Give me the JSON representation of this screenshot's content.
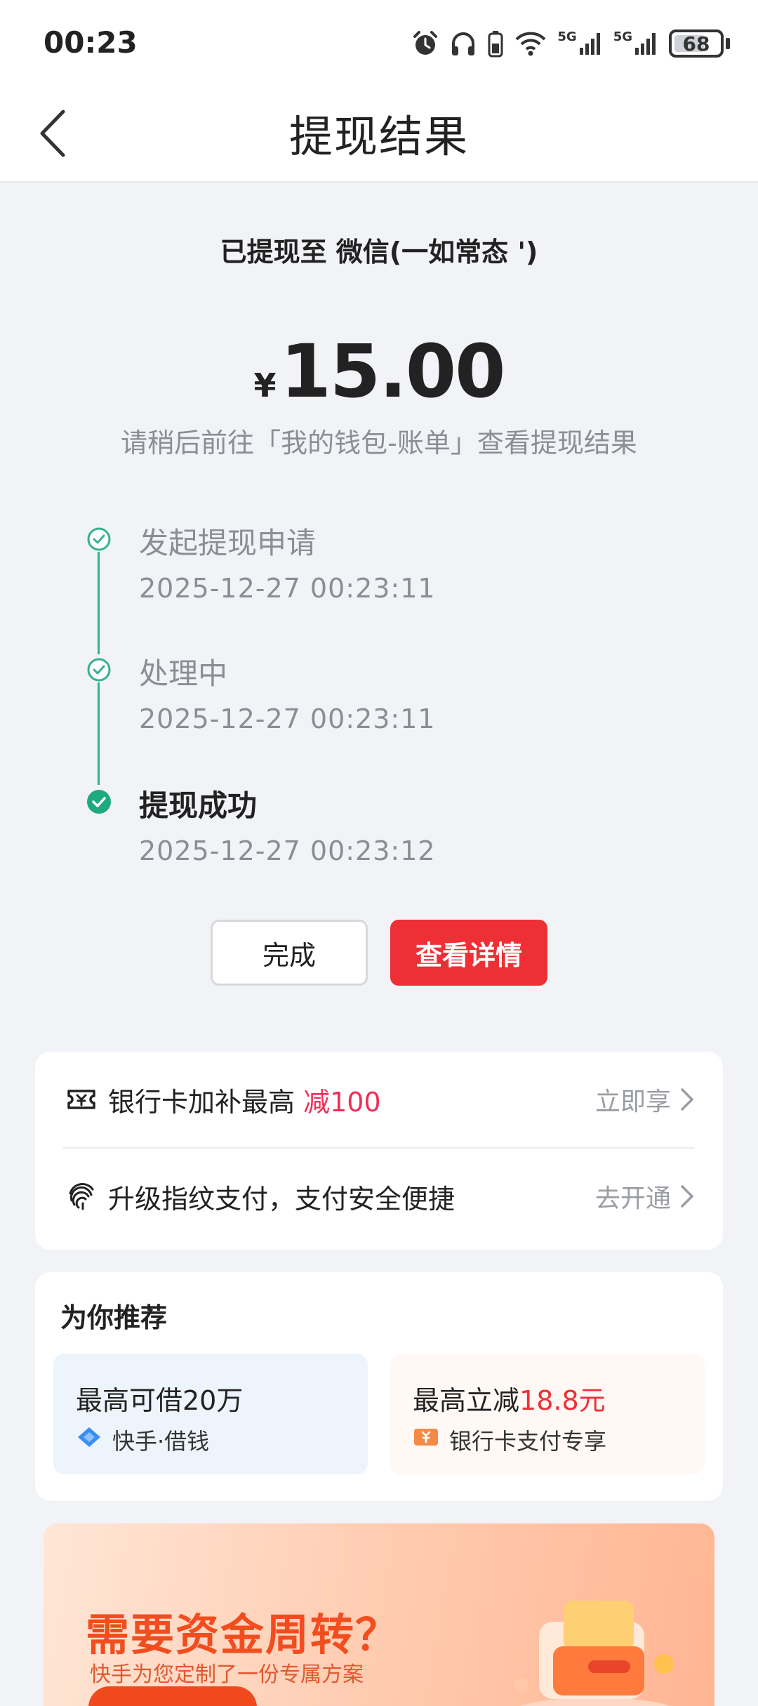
{
  "status_bar": {
    "time": "00:23",
    "battery": "68",
    "battery_level": 0.68,
    "signal_label_1": "5G",
    "signal_label_2": "5G",
    "icons": [
      "alarm-icon",
      "headphones-icon",
      "phone-battery-icon",
      "wifi-icon",
      "signal-5g-icon",
      "signal-5g-icon",
      "battery-icon"
    ]
  },
  "header": {
    "title": "提现结果",
    "back_icon": "chevron-left-icon"
  },
  "result": {
    "destination": "已提现至 微信(一如常态 ')",
    "currency": "¥",
    "amount": "15.00",
    "hint": "请稍后前往「我的钱包-账单」查看提现结果"
  },
  "timeline": [
    {
      "title": "发起提现申请",
      "time": "2025-12-27 00:23:11",
      "state": "passed"
    },
    {
      "title": "处理中",
      "time": "2025-12-27 00:23:11",
      "state": "passed"
    },
    {
      "title": "提现成功",
      "time": "2025-12-27 00:23:12",
      "state": "current"
    }
  ],
  "actions": {
    "done": "完成",
    "detail": "查看详情"
  },
  "promos": [
    {
      "icon": "ticket-icon",
      "text": "银行卡加补最高 ",
      "highlight": "减100",
      "action": "立即享"
    },
    {
      "icon": "fingerprint-icon",
      "text": "升级指纹支付，支付安全便捷",
      "action": "去开通"
    }
  ],
  "recommend": {
    "title": "为你推荐",
    "tiles": [
      {
        "main": "最高可借20万",
        "highlight": "",
        "sub": "快手·借钱",
        "icon": "diamond-icon"
      },
      {
        "main": "最高立减",
        "highlight": "18.8元",
        "sub": "银行卡支付专享",
        "icon": "coupon-icon"
      }
    ]
  },
  "banner": {
    "title": "需要资金周转？",
    "subtitle": "快手为您定制了一份专属方案"
  },
  "colors": {
    "accent_red": "#ef2f36",
    "highlight_pink": "#ef2f57",
    "timeline_green": "#1fa97f",
    "banner_orange": "#f24d1f"
  }
}
